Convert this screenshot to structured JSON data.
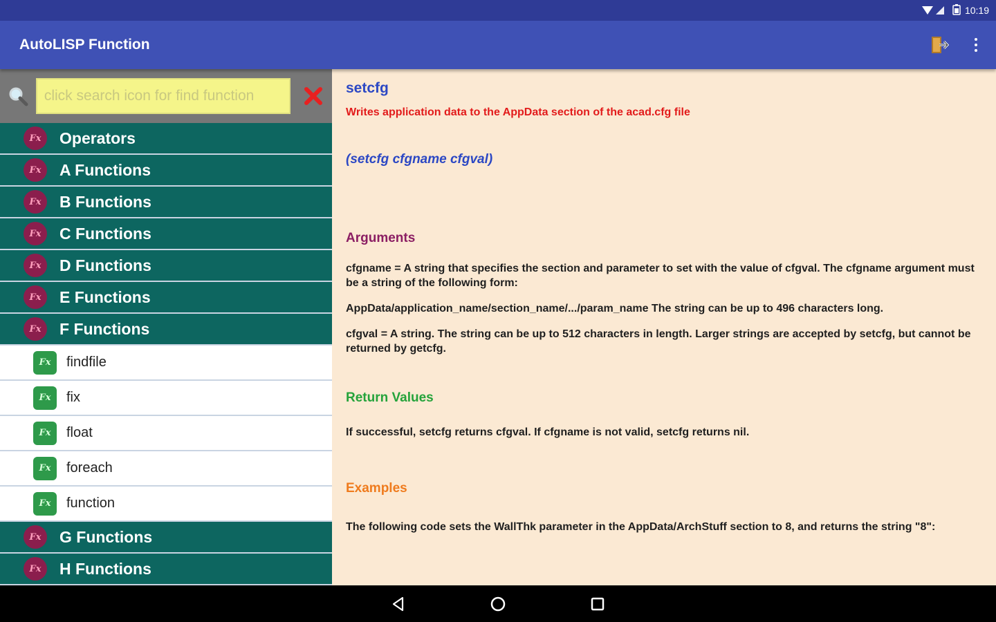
{
  "status": {
    "time": "10:19"
  },
  "app": {
    "title": "AutoLISP Function"
  },
  "search": {
    "placeholder": "click search icon for find function"
  },
  "icons": {
    "fx_group_glyph": "Fx",
    "fx_child_glyph": "Fx"
  },
  "groups_before": [
    {
      "label": "Operators"
    },
    {
      "label": "A Functions"
    },
    {
      "label": "B Functions"
    },
    {
      "label": "C Functions"
    },
    {
      "label": "D Functions"
    },
    {
      "label": "E Functions"
    },
    {
      "label": "F Functions"
    }
  ],
  "children": [
    {
      "label": "findfile"
    },
    {
      "label": "fix"
    },
    {
      "label": "float"
    },
    {
      "label": "foreach"
    },
    {
      "label": "function"
    }
  ],
  "groups_after": [
    {
      "label": "G Functions"
    },
    {
      "label": "H Functions"
    }
  ],
  "detail": {
    "name": "setcfg",
    "description": "Writes application data to the AppData section of the acad.cfg file",
    "syntax": "(setcfg cfgname cfgval)",
    "arguments_heading": "Arguments",
    "arg_para1": "cfgname = A string that specifies the section and parameter to set with the value of cfgval. The cfgname argument must be a string of the following form:",
    "arg_para2": "AppData/application_name/section_name/.../param_name The string can be up to 496 characters long.",
    "arg_para3": "cfgval = A string. The string can be up to 512 characters in length. Larger strings are accepted by setcfg, but cannot be returned by getcfg.",
    "return_heading": "Return Values",
    "return_para": "If successful, setcfg returns cfgval. If cfgname is not valid, setcfg returns nil.",
    "examples_heading": "Examples",
    "example_para": "The following code sets the WallThk parameter in the AppData/ArchStuff section to 8, and returns the string \"8\":"
  },
  "colors": {
    "app_bar": "#3f51b5",
    "status_bar": "#2f3b96",
    "group_row": "#0d6660",
    "detail_bg": "#fbe9d3",
    "name": "#2c48c4",
    "description": "#e21b1b",
    "arguments": "#8b1e63",
    "return_values": "#25a33b",
    "examples": "#ef7b1d"
  }
}
